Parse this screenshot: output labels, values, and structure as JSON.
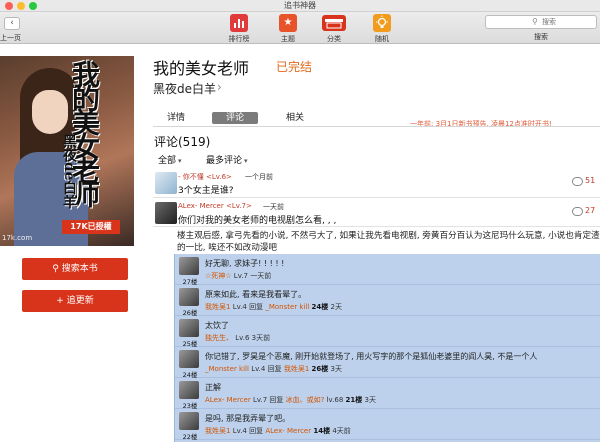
{
  "window": {
    "title": "追书神器"
  },
  "toolbar": {
    "back_label": "上一页",
    "items": [
      {
        "label": "排行榜",
        "color": "#e03a3a"
      },
      {
        "label": "主题",
        "color": "#e8532a"
      },
      {
        "label": "分类",
        "color": "#d8341b"
      },
      {
        "label": "随机",
        "color": "#f29c1f"
      }
    ],
    "search": {
      "placeholder": "搜索",
      "label": "搜索"
    }
  },
  "cover": {
    "title_big": "我的美女老师",
    "title_small": "黑夜de白羊",
    "badge": "17K已授權",
    "caption": "17k.com"
  },
  "actions": {
    "search_book": "搜索本书",
    "follow": "追更新"
  },
  "book": {
    "title": "我的美女老师",
    "status": "已完结",
    "author": "黑夜de白羊"
  },
  "tabs": {
    "detail": "详情",
    "comments": "评论",
    "related": "相关"
  },
  "notice": "一年前: 3月1日新书预告, 凌晨12点准时开书!",
  "comments": {
    "header": "评论(519)",
    "filter_all": "全部",
    "filter_sort": "最多评论",
    "items": [
      {
        "user": "- 你不懂 <Lv.6>",
        "time": "一个月前",
        "text": "3个女主是谁?",
        "count": "51"
      },
      {
        "user": "ALex- Mercer <Lv.7>",
        "time": "一天前",
        "text": "你们对我的美女老师的电视剧怎么看, , ,",
        "count": "27"
      }
    ],
    "long_text": "楼主观后感, 拿弓先看的小说, 不然弓大了, 如果让我先看电视剧, 旁黄百分百认为这尼玛什么玩意, 小说也肯定渣的一比, 唉还不如改动漫吧"
  },
  "replies": [
    {
      "floor": "27楼",
      "text": "好无聊, 求妹子! ! ! ! !",
      "user": "☆死神☆",
      "level": "Lv.7",
      "time": "一天前"
    },
    {
      "floor": "26楼",
      "text": "原来如此, 看来是我看晕了。",
      "user": "我姓吴1",
      "level": "Lv.4",
      "reply_to": "_Monster kill",
      "reply_word": "回复",
      "reply_floor": "24楼",
      "time": "2天"
    },
    {
      "floor": "25楼",
      "text": "太饮了",
      "user": "独先生、",
      "level": "Lv.6",
      "time": "3天前"
    },
    {
      "floor": "24楼",
      "text": "你记错了, 罗昊是个恶魔, 刚开始就登场了, 用火写字的那个是狐仙老婆里的阎人昊, 不是一个人",
      "user": "_Monster kill",
      "level": "Lv.4",
      "reply_to": "我姓吴1",
      "reply_word": "回复",
      "reply_floor": "26楼",
      "time": "3天"
    },
    {
      "floor": "23楼",
      "text": "正解",
      "user": "ALex- Mercer",
      "level": "Lv.7",
      "reply_to": "冰血、或如?",
      "reply_word": "回复",
      "reply_level": "lv.68",
      "reply_floor": "21楼",
      "time": "3天"
    },
    {
      "floor": "22楼",
      "text": "是吗, 那是我弄晕了吧。",
      "user": "我姓吴1",
      "level": "Lv.4",
      "reply_to": "ALex- Mercer",
      "reply_word": "回复",
      "reply_floor": "14楼",
      "time": "4天前"
    }
  ]
}
